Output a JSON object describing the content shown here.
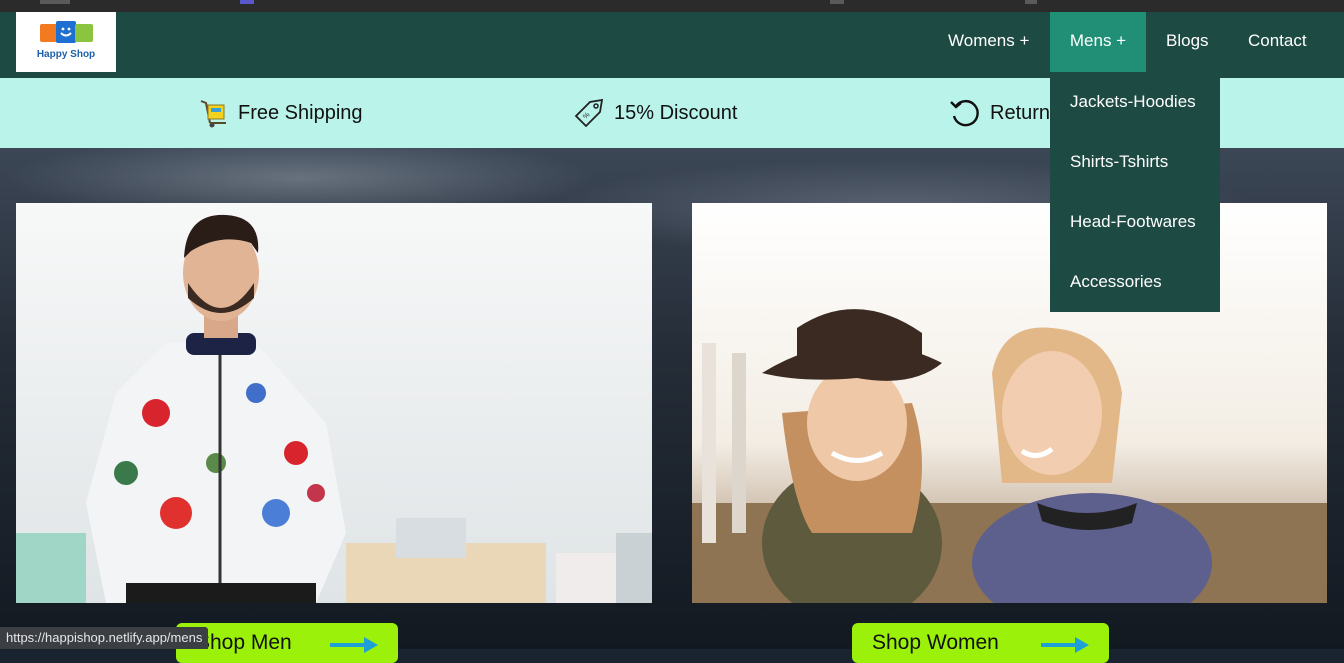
{
  "brand": {
    "logo_text": "Happy Shop"
  },
  "nav": {
    "womens": "Womens +",
    "mens": "Mens +",
    "blogs": "Blogs",
    "contact": "Contact"
  },
  "mens_dropdown": [
    "Jackets-Hoodies",
    "Shirts-Tshirts",
    "Head-Footwares",
    "Accessories"
  ],
  "features": {
    "shipping": "Free Shipping",
    "discount": "15% Discount",
    "returns": "Return"
  },
  "cards": {
    "men_button": "Shop Men",
    "women_button": "Shop Women"
  },
  "status_url": "https://happishop.netlify.app/mens",
  "colors": {
    "navbar": "#1e4a44",
    "nav_active": "#218f76",
    "feature_bar": "#baf3ea",
    "button": "#9cf10a",
    "arrow": "#1e9fd6"
  }
}
